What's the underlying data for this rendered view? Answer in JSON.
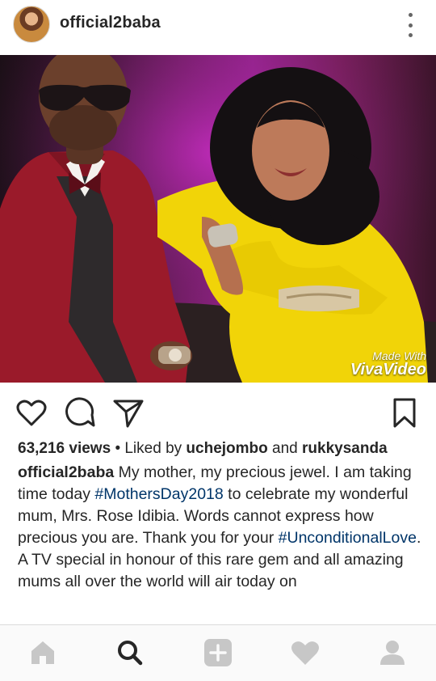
{
  "post": {
    "username": "official2baba",
    "watermark": {
      "line1": "Made With",
      "line2": "VivaVideo"
    },
    "views": "63,216 views",
    "liked_prefix": "• Liked by",
    "liked_user1": "uchejombo",
    "liked_and": "and",
    "liked_user2": "rukkysanda",
    "caption": {
      "user": "official2baba",
      "part1": "My mother, my precious jewel. I am taking time today",
      "hashtag1": "#MothersDay2018",
      "part2": "to celebrate my wonderful mum, Mrs. Rose Idibia. Words cannot express how precious you are. Thank you for your",
      "hashtag2": "#UnconditionalLove",
      "part3": ". A TV special in honour of this rare gem and all amazing mums all over the world will air today on"
    }
  },
  "icons": {
    "more": "more-vertical-icon",
    "like": "heart-outline-icon",
    "comment": "comment-icon",
    "share": "send-icon",
    "save": "bookmark-icon",
    "tabs": [
      "home-icon",
      "search-icon",
      "add-icon",
      "activity-heart-icon",
      "profile-icon"
    ]
  },
  "colors": {
    "text": "#262626",
    "hashtag": "#003569",
    "background": "#ffffff",
    "tabbar": "#fafafa"
  }
}
